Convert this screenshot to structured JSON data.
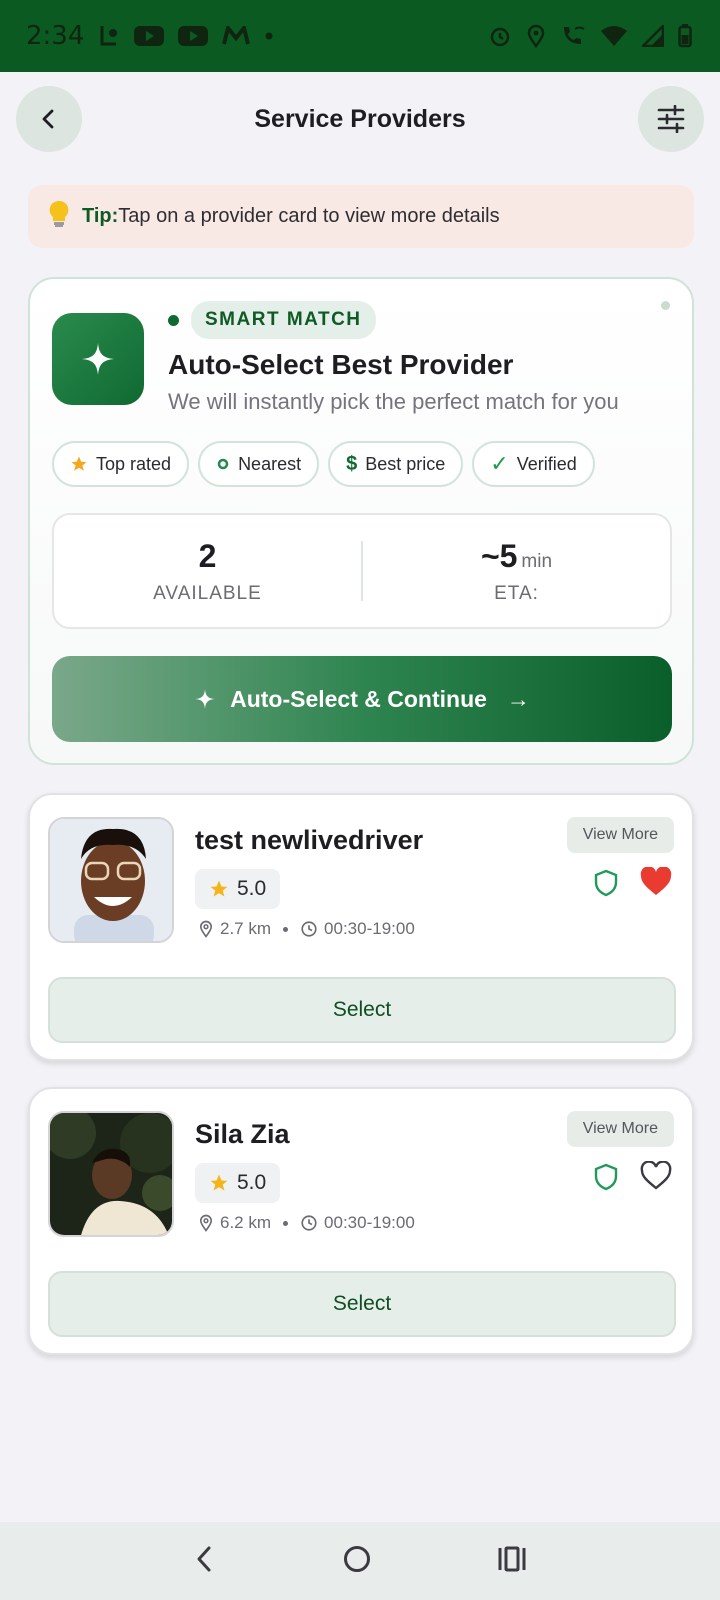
{
  "status_bar": {
    "time": "2:34",
    "bg_color": "#0a5a22"
  },
  "header": {
    "title": "Service Providers",
    "back_icon": "chevron-left-icon",
    "filter_icon": "sliders-icon"
  },
  "tip": {
    "label": "Tip:",
    "text": "Tap on a provider card to view more details"
  },
  "smart_match": {
    "badge": "SMART MATCH",
    "title": "Auto-Select Best Provider",
    "subtitle": "We will instantly pick the perfect match for you",
    "chips": [
      {
        "label": "Top rated",
        "icon": "star-icon"
      },
      {
        "label": "Nearest",
        "icon": "dot-icon"
      },
      {
        "label": "Best price",
        "icon": "dollar-icon"
      },
      {
        "label": "Verified",
        "icon": "check-icon"
      }
    ],
    "stats": {
      "available_value": "2",
      "available_label": "AVAILABLE",
      "eta_value": "~5",
      "eta_unit": "min",
      "eta_label": "ETA:"
    },
    "cta_label": "Auto-Select & Continue",
    "cta_arrow": "→",
    "accent_color": "#0f6a32"
  },
  "providers": [
    {
      "name": "test newlivedriver",
      "rating": "5.0",
      "distance": "2.7 km",
      "hours": "00:30-19:00",
      "view_more": "View More",
      "favorited": true,
      "select_label": "Select"
    },
    {
      "name": "Sila Zia",
      "rating": "5.0",
      "distance": "6.2 km",
      "hours": "00:30-19:00",
      "view_more": "View More",
      "favorited": false,
      "select_label": "Select"
    }
  ]
}
